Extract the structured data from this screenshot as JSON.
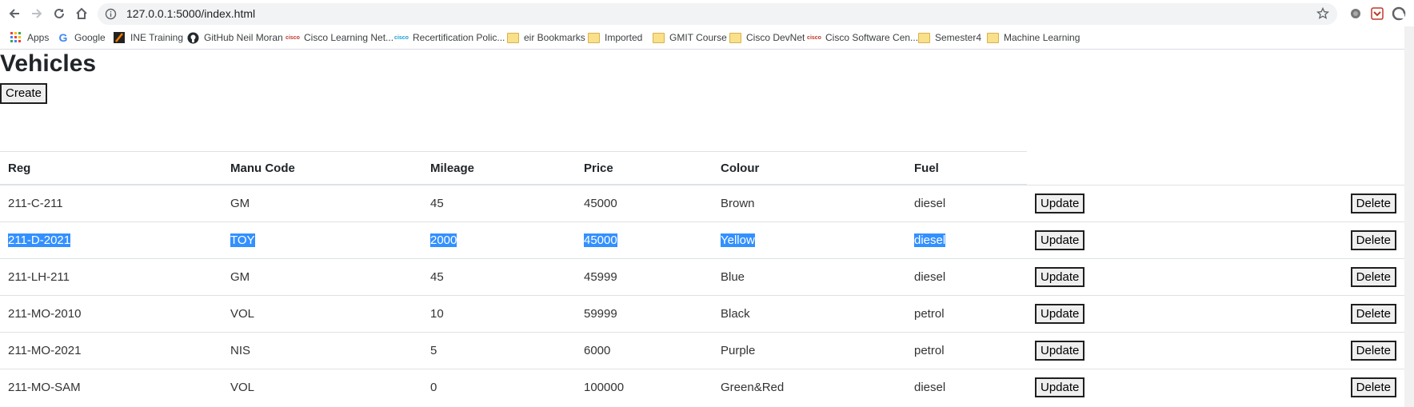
{
  "browser": {
    "url": "127.0.0.1:5000/index.html",
    "bookmarks": [
      {
        "label": "Apps",
        "icon": "apps-grid-icon"
      },
      {
        "label": "Google",
        "icon": "google-icon"
      },
      {
        "label": "INE Training",
        "icon": "ine-icon"
      },
      {
        "label": "GitHub Neil Moran",
        "icon": "github-icon"
      },
      {
        "label": "Cisco Learning Net...",
        "icon": "cisco-icon"
      },
      {
        "label": "Recertification Polic...",
        "icon": "cisco-icon"
      },
      {
        "label": "eir Bookmarks",
        "icon": "folder-icon"
      },
      {
        "label": "Imported",
        "icon": "folder-icon"
      },
      {
        "label": "GMIT Course",
        "icon": "folder-icon"
      },
      {
        "label": "Cisco DevNet",
        "icon": "folder-icon"
      },
      {
        "label": "Cisco Software Cen...",
        "icon": "cisco-icon"
      },
      {
        "label": "Semester4",
        "icon": "folder-icon"
      },
      {
        "label": "Machine Learning",
        "icon": "folder-icon"
      }
    ]
  },
  "page": {
    "title": "Vehicles",
    "create_label": "Create",
    "columns": [
      "Reg",
      "Manu Code",
      "Mileage",
      "Price",
      "Colour",
      "Fuel"
    ],
    "update_label": "Update",
    "delete_label": "Delete",
    "rows": [
      {
        "reg": "211-C-211",
        "manu": "GM",
        "mileage": "45",
        "price": "45000",
        "colour": "Brown",
        "fuel": "diesel"
      },
      {
        "reg": "211-D-2021",
        "manu": "TOY",
        "mileage": "2000",
        "price": "45000",
        "colour": "Yellow",
        "fuel": "diesel",
        "selected": true
      },
      {
        "reg": "211-LH-211",
        "manu": "GM",
        "mileage": "45",
        "price": "45999",
        "colour": "Blue",
        "fuel": "diesel"
      },
      {
        "reg": "211-MO-2010",
        "manu": "VOL",
        "mileage": "10",
        "price": "59999",
        "colour": "Black",
        "fuel": "petrol"
      },
      {
        "reg": "211-MO-2021",
        "manu": "NIS",
        "mileage": "5",
        "price": "6000",
        "colour": "Purple",
        "fuel": "petrol"
      },
      {
        "reg": "211-MO-SAM",
        "manu": "VOL",
        "mileage": "0",
        "price": "100000",
        "colour": "Green&Red",
        "fuel": "diesel"
      }
    ]
  },
  "colors": {
    "selection": "#3390ff",
    "border": "#dee2e6"
  }
}
